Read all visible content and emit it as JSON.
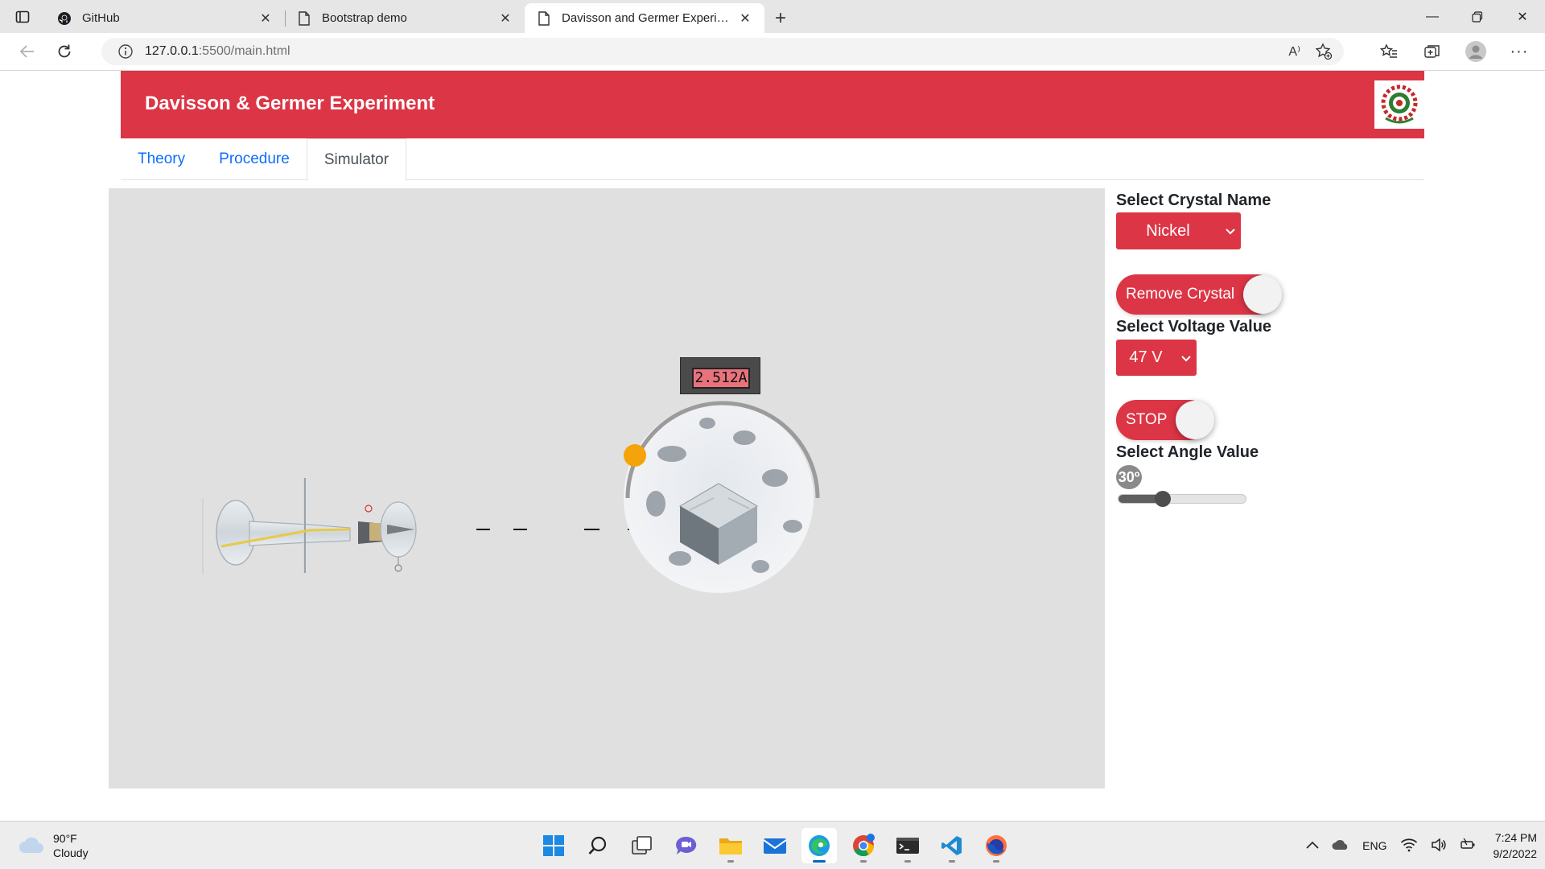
{
  "browser": {
    "tabs": [
      {
        "title": "GitHub",
        "icon": "github-icon"
      },
      {
        "title": "Bootstrap demo",
        "icon": "page-icon"
      },
      {
        "title": "Davisson and Germer Experiment",
        "icon": "page-icon",
        "active": true
      }
    ],
    "url_host": "127.0.0.1",
    "url_path": ":5500/main.html",
    "read_aloud_label": "A⁾"
  },
  "page": {
    "title": "Davisson & Germer Experiment",
    "nav": [
      "Theory",
      "Procedure",
      "Simulator"
    ],
    "active_nav": "Simulator",
    "brand_color": "#dc3545"
  },
  "simulator": {
    "ammeter_reading": "2.512A",
    "crystal_label": "Select Crystal Name",
    "crystal_value": "Nickel",
    "remove_crystal_label": "Remove Crystal",
    "voltage_label": "Select Voltage Value",
    "voltage_value": "47 V",
    "stop_label": "STOP",
    "angle_label": "Select Angle Value",
    "angle_value": "30º",
    "angle_slider_fraction": 0.35
  },
  "taskbar": {
    "temperature": "90°F",
    "weather": "Cloudy",
    "language": "ENG",
    "time": "7:24 PM",
    "date": "9/2/2022"
  }
}
